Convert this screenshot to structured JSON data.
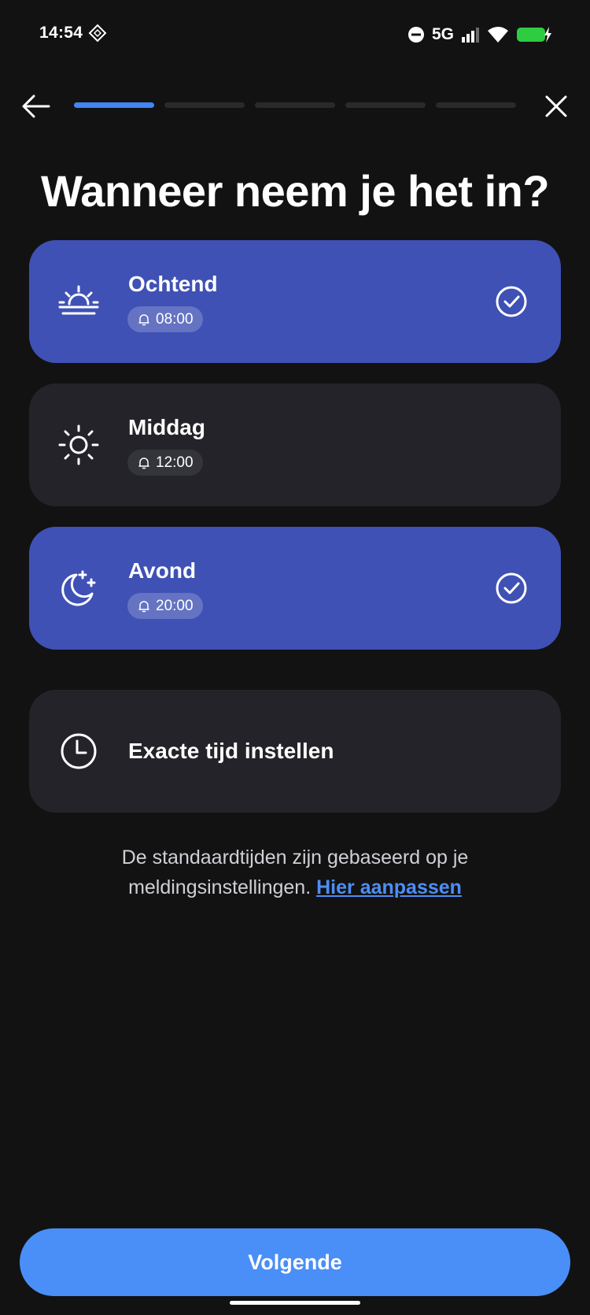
{
  "status_bar": {
    "time": "14:54",
    "network": "5G",
    "icons": [
      "diamond-notification-icon",
      "do-not-disturb-icon",
      "signal-icon",
      "wifi-icon",
      "battery-charging-icon"
    ],
    "battery_color": "#2ecc40"
  },
  "nav": {
    "back_icon": "arrow-left-icon",
    "close_icon": "close-icon",
    "progress": {
      "current_step": 1,
      "total_steps": 5
    }
  },
  "title": "Wanneer neem je het in?",
  "options": [
    {
      "label": "Ochtend",
      "time": "08:00",
      "icon": "sunrise-icon",
      "selected": true
    },
    {
      "label": "Middag",
      "time": "12:00",
      "icon": "sun-icon",
      "selected": false
    },
    {
      "label": "Avond",
      "time": "20:00",
      "icon": "moon-stars-icon",
      "selected": true
    },
    {
      "label": "Exacte tijd instellen",
      "icon": "clock-icon",
      "selected": false
    }
  ],
  "note": {
    "text": "De standaardtijden zijn gebaseerd op je meldingsinstellingen.",
    "link": "Hier aanpassen"
  },
  "cta": {
    "label": "Volgende"
  },
  "colors": {
    "background": "#121212",
    "card": "#232329",
    "card_selected": "#3f51b5",
    "accent": "#4a8ef7",
    "link": "#4d8ef7"
  }
}
